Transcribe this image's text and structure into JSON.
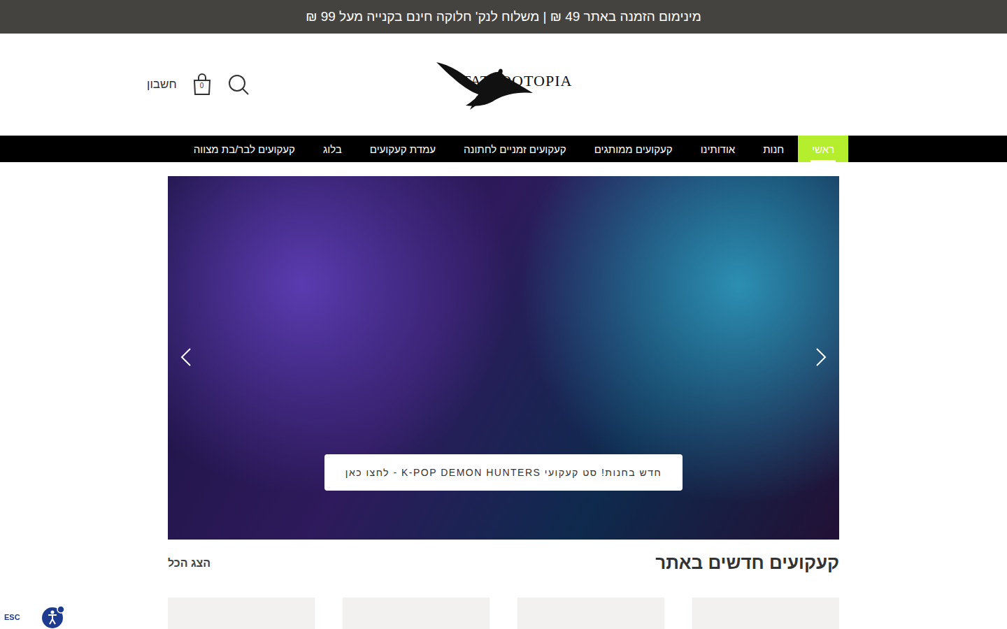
{
  "announcement": "מינימום הזמנה באתר 49 ₪ | משלוח לנק' חלוקה חינם בקנייה מעל 99 ₪",
  "header": {
    "logo": "TATTOOTOPIA",
    "account": "חשבון",
    "cart_count": "0"
  },
  "nav": [
    {
      "label": "ראשי",
      "selected": true
    },
    {
      "label": "חנות",
      "selected": false
    },
    {
      "label": "אודותינו",
      "selected": false
    },
    {
      "label": "קעקועים ממותגים",
      "selected": false
    },
    {
      "label": "קעקועים זמניים לחתונה",
      "selected": false
    },
    {
      "label": "עמדת קעקועים",
      "selected": false
    },
    {
      "label": "בלוג",
      "selected": false
    },
    {
      "label": "קעקועים לבר/בת מצווה",
      "selected": false
    }
  ],
  "hero": {
    "caption": "חדש בחנות! סט קעקועי K-POP DEMON HUNTERS - לחצו כאן"
  },
  "new_products": {
    "title": "קעקועים חדשים באתר",
    "view_all": "הצג הכל",
    "items": [
      {
        "kind": "photo"
      },
      {
        "kind": "photo"
      },
      {
        "kind": "photo"
      },
      {
        "kind": "photo"
      }
    ]
  },
  "accessibility": {
    "label": "ESC"
  }
}
